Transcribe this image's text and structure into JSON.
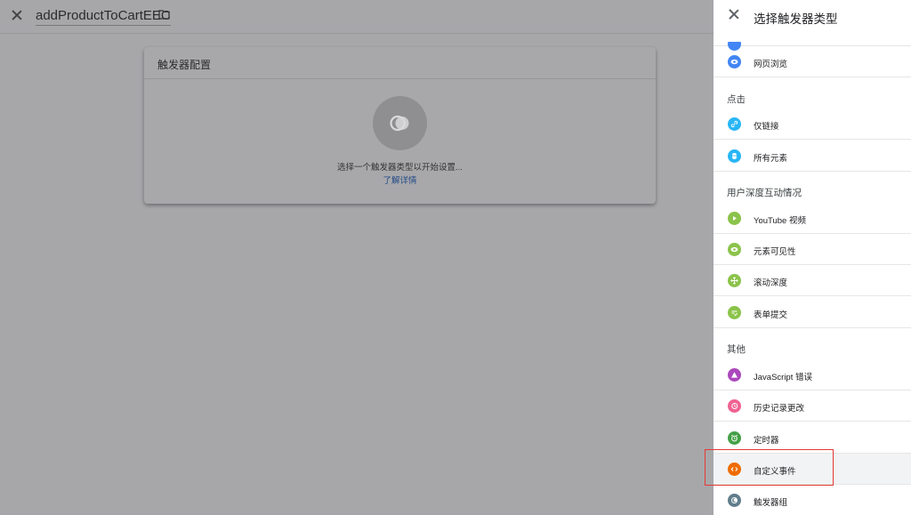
{
  "editor": {
    "trigger_name": "addProductToCartEEC",
    "config_card": {
      "title": "触发器配置",
      "hint": "选择一个触发器类型以开始设置...",
      "link": "了解详情"
    }
  },
  "panel": {
    "title": "选择触发器类型",
    "sections": {
      "click": "点击",
      "engagement": "用户深度互动情况",
      "other": "其他"
    },
    "items": {
      "pageview": "网页浏览",
      "just_links": "仅链接",
      "all_elements": "所有元素",
      "youtube": "YouTube 视频",
      "visibility": "元素可见性",
      "scroll": "滚动深度",
      "form": "表单提交",
      "js_error": "JavaScript 错误",
      "history": "历史记录更改",
      "timer": "定时器",
      "custom_event": "自定义事件",
      "trigger_group": "触发器组"
    },
    "colors": {
      "blue": "#4285f4",
      "light_blue": "#29b6f6",
      "green": "#8bc34a",
      "purple": "#ab47bc",
      "pink": "#f06292",
      "dark_green": "#43a047",
      "orange": "#ef6c00",
      "slate": "#607d8b",
      "highlight_border": "#e53935"
    }
  }
}
